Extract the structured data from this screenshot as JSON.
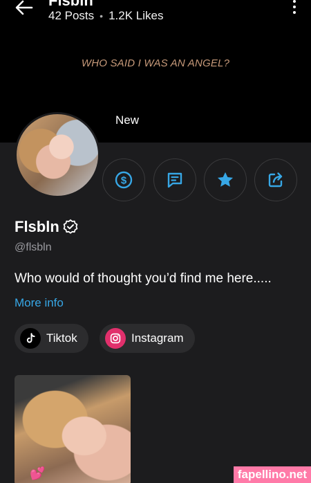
{
  "header": {
    "title": "Flsbln",
    "posts": "42 Posts",
    "separator": "•",
    "likes": "1.2K Likes",
    "cover_text": "WHO SAID I WAS AN ANGEL?",
    "new_label": "New"
  },
  "profile": {
    "name": "Flsbln",
    "handle": "@flsbln",
    "bio": "Who would of thought you’d find me here.....",
    "more_info": "More info"
  },
  "actions": [
    {
      "icon": "dollar-icon"
    },
    {
      "icon": "message-icon"
    },
    {
      "icon": "star-icon"
    },
    {
      "icon": "share-icon"
    }
  ],
  "links": [
    {
      "label": "Tiktok",
      "icon": "tiktok-icon"
    },
    {
      "label": "Instagram",
      "icon": "instagram-icon"
    }
  ],
  "watermark": "fapellino.net",
  "colors": {
    "accent": "#37a7e6",
    "background": "#1c1c1e",
    "instagram": "#e1306c",
    "watermark": "#ff7aa8"
  }
}
